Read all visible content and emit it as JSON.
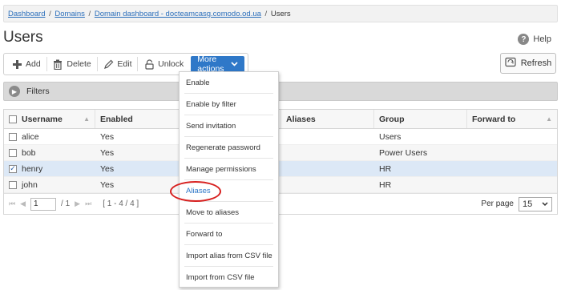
{
  "breadcrumb": {
    "dashboard": "Dashboard",
    "domains": "Domains",
    "domain_dashboard": "Domain dashboard - docteamcasg.comodo.od.ua",
    "current": "Users",
    "separator": "/"
  },
  "page": {
    "title": "Users",
    "help": "Help"
  },
  "toolbar": {
    "add": "Add",
    "delete": "Delete",
    "edit": "Edit",
    "unlock": "Unlock",
    "more_actions": "More actions",
    "refresh": "Refresh"
  },
  "filters": {
    "label": "Filters"
  },
  "grid": {
    "columns": {
      "username": "Username",
      "enabled": "Enabled",
      "aliases": "Aliases",
      "group": "Group",
      "forward_to": "Forward to"
    },
    "rows": [
      {
        "username": "alice",
        "enabled": "Yes",
        "aliases": "",
        "group": "Users",
        "forward_to": "",
        "checked": false
      },
      {
        "username": "bob",
        "enabled": "Yes",
        "aliases": "",
        "group": "Power Users",
        "forward_to": "",
        "checked": false
      },
      {
        "username": "henry",
        "enabled": "Yes",
        "aliases": "",
        "group": "HR",
        "forward_to": "",
        "checked": true
      },
      {
        "username": "john",
        "enabled": "Yes",
        "aliases": "",
        "group": "HR",
        "forward_to": "",
        "checked": false
      }
    ]
  },
  "pager": {
    "page_value": "1",
    "page_total": "/ 1",
    "range": "[ 1 - 4 / 4 ]",
    "per_page_label": "Per page",
    "per_page_value": "15"
  },
  "menu": {
    "items": [
      "Enable",
      "Enable by filter",
      "Send invitation",
      "Regenerate password",
      "Manage permissions",
      "Aliases",
      "Move to aliases",
      "Forward to",
      "Import alias from CSV file",
      "Import from CSV file"
    ],
    "highlighted_item": "Aliases"
  },
  "colors": {
    "accent": "#2f78c8",
    "highlight_ring": "#d7201f",
    "selected_row": "#dce8f6"
  }
}
